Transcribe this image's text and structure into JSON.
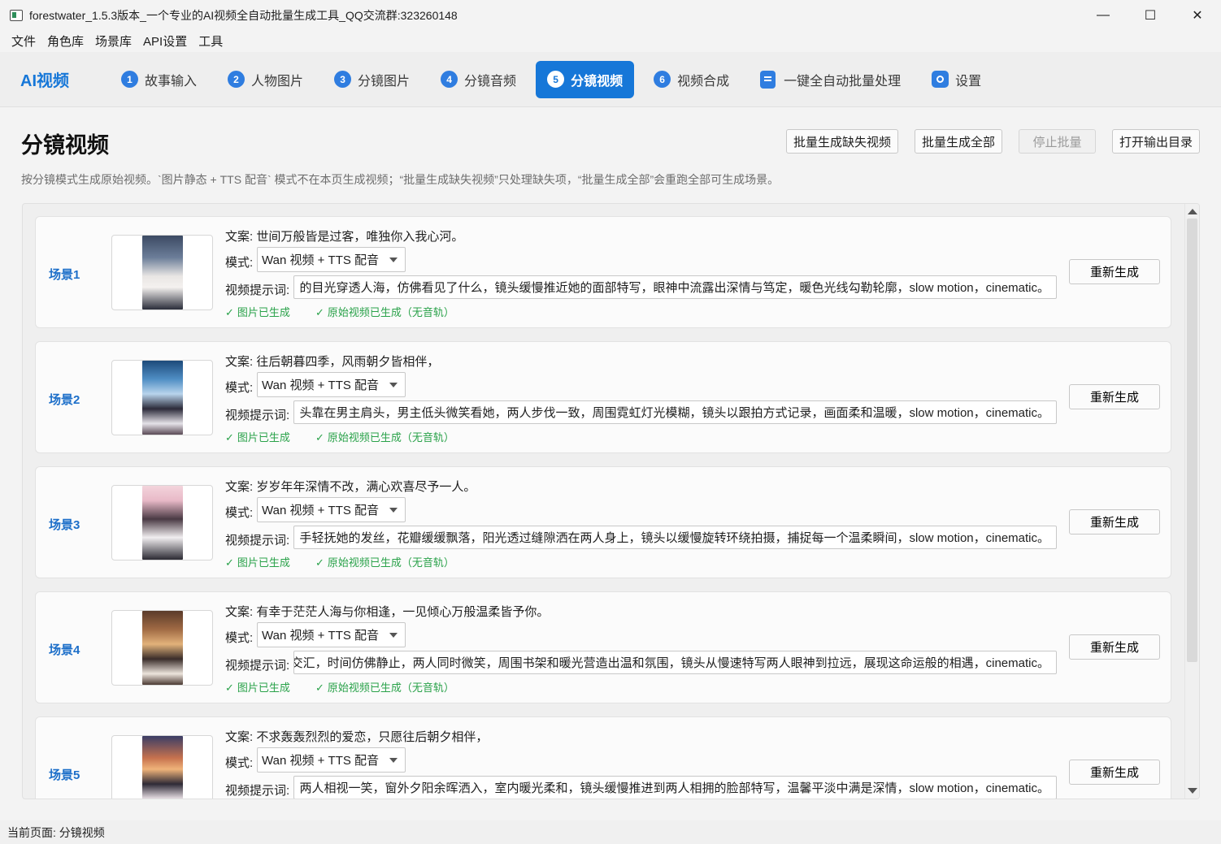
{
  "window": {
    "title": "forestwater_1.5.3版本_一个专业的AI视频全自动批量生成工具_QQ交流群:323260148",
    "controls": [
      "—",
      "☐",
      "✕"
    ]
  },
  "menu": [
    "文件",
    "角色库",
    "场景库",
    "API设置",
    "工具"
  ],
  "nav": {
    "brand": "AI视频",
    "tabs": [
      {
        "num": "1",
        "label": "故事输入"
      },
      {
        "num": "2",
        "label": "人物图片"
      },
      {
        "num": "3",
        "label": "分镜图片"
      },
      {
        "num": "4",
        "label": "分镜音频"
      },
      {
        "num": "5",
        "label": "分镜视频"
      },
      {
        "num": "6",
        "label": "视频合成"
      },
      {
        "num": "",
        "label": "一键全自动批量处理"
      },
      {
        "num": "",
        "label": "设置"
      }
    ],
    "active_index": 4
  },
  "page": {
    "title": "分镜视频",
    "description": "按分镜模式生成原始视频。`图片静态 + TTS 配音` 模式不在本页生成视频；“批量生成缺失视频”只处理缺失项，“批量生成全部”会重跑全部可生成场景。",
    "actions": {
      "generate_missing": "批量生成缺失视频",
      "generate_all": "批量生成全部",
      "stop_batch": "停止批量",
      "open_output": "打开输出目录"
    }
  },
  "labels": {
    "copy_prefix": "文案: ",
    "mode": "模式:",
    "prompt": "视频提示词:",
    "regenerate": "重新生成",
    "status_image": "图片已生成",
    "status_video": "原始视频已生成（无音轨）",
    "check": "✓"
  },
  "scenes": [
    {
      "label": "场景1",
      "copy": "世间万般皆是过客，唯独你入我心河。",
      "mode": "Wan 视频 + TTS 配音",
      "prompt": "的目光穿透人海，仿佛看见了什么，镜头缓慢推近她的面部特写，眼神中流露出深情与笃定，暖色光线勾勒轮廓，slow motion，cinematic。"
    },
    {
      "label": "场景2",
      "copy": "往后朝暮四季，风雨朝夕皆相伴，",
      "mode": "Wan 视频 + TTS 配音",
      "prompt": "头靠在男主肩头，男主低头微笑看她，两人步伐一致，周围霓虹灯光模糊，镜头以跟拍方式记录，画面柔和温暖，slow motion，cinematic。"
    },
    {
      "label": "场景3",
      "copy": "岁岁年年深情不改，满心欢喜尽予一人。",
      "mode": "Wan 视频 + TTS 配音",
      "prompt": "手轻抚她的发丝，花瓣缓缓飘落，阳光透过缝隙洒在两人身上，镜头以缓慢旋转环绕拍摄，捕捉每一个温柔瞬间，slow motion，cinematic。"
    },
    {
      "label": "场景4",
      "copy": "有幸于茫茫人海与你相逢，一见倾心万般温柔皆予你。",
      "mode": "Wan 视频 + TTS 配音",
      "prompt": "交汇，时间仿佛静止，两人同时微笑，周围书架和暖光营造出温和氛围，镜头从慢速特写两人眼神到拉远，展现这命运般的相遇，cinematic。"
    },
    {
      "label": "场景5",
      "copy": "不求轰轰烈烈的爱恋，只愿往后朝夕相伴，",
      "mode": "Wan 视频 + TTS 配音",
      "prompt": "两人相视一笑，窗外夕阳余晖洒入，室内暖光柔和，镜头缓慢推进到两人相拥的脸部特写，温馨平淡中满是深情，slow motion，cinematic。"
    }
  ],
  "statusbar": {
    "text": "当前页面: 分镜视频"
  },
  "colors": {
    "accent": "#1677d8",
    "success": "#2aa24a",
    "scene_label": "#1d6fc9"
  }
}
